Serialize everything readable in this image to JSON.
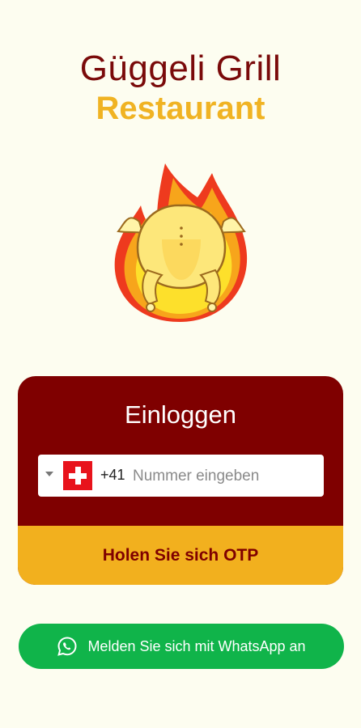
{
  "brand": {
    "title": "Güggeli Grill",
    "subtitle": "Restaurant",
    "logo_icon": "flaming-chicken-icon"
  },
  "login": {
    "title": "Einloggen",
    "country_flag_icon": "swiss-flag-icon",
    "dial_code": "+41",
    "phone_value": "",
    "phone_placeholder": "Nummer eingeben",
    "otp_button_label": "Holen Sie sich OTP"
  },
  "whatsapp": {
    "icon": "whatsapp-icon",
    "label": "Melden Sie sich mit WhatsApp an"
  },
  "colors": {
    "background": "#fdfdf0",
    "brand_maroon": "#7f0000",
    "brand_yellow": "#f2b01e",
    "whatsapp_green": "#10b44a"
  }
}
